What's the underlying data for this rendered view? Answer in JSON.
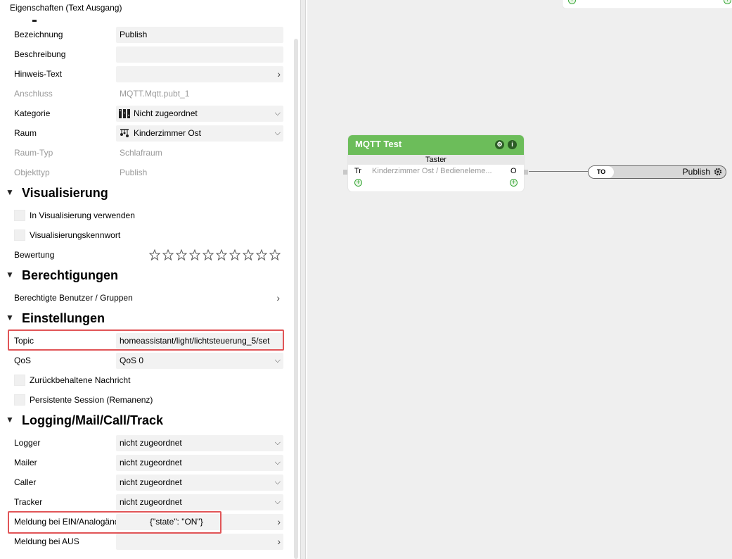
{
  "panel_title": "Eigenschaften (Text Ausgang)",
  "general": {
    "bezeichnung": {
      "label": "Bezeichnung",
      "value": "Publish"
    },
    "beschreibung": {
      "label": "Beschreibung",
      "value": ""
    },
    "hinweis": {
      "label": "Hinweis-Text",
      "value": ""
    },
    "anschluss": {
      "label": "Anschluss",
      "value": "MQTT.Mqtt.pubt_1"
    },
    "kategorie": {
      "label": "Kategorie",
      "value": "Nicht zugeordnet"
    },
    "raum": {
      "label": "Raum",
      "value": "Kinderzimmer Ost"
    },
    "raum_typ": {
      "label": "Raum-Typ",
      "value": "Schlafraum"
    },
    "objekttyp": {
      "label": "Objekttyp",
      "value": "Publish"
    }
  },
  "visualisierung": {
    "title": "Visualisierung",
    "in_vis": "In Visualisierung verwenden",
    "kennwort": "Visualisierungskennwort",
    "bewertung": "Bewertung",
    "stars_total": 10,
    "stars_filled": 0
  },
  "berechtigungen": {
    "title": "Berechtigungen",
    "benutzer": "Berechtigte Benutzer / Gruppen"
  },
  "einstellungen": {
    "title": "Einstellungen",
    "topic": {
      "label": "Topic",
      "value": "homeassistant/light/lichtsteuerung_5/set"
    },
    "qos": {
      "label": "QoS",
      "value": "QoS 0"
    },
    "retain": "Zurückbehaltene Nachricht",
    "persistent": "Persistente Session (Remanenz)"
  },
  "logging": {
    "title": "Logging/Mail/Call/Track",
    "logger": {
      "label": "Logger",
      "value": "nicht zugeordnet"
    },
    "mailer": {
      "label": "Mailer",
      "value": "nicht zugeordnet"
    },
    "caller": {
      "label": "Caller",
      "value": "nicht zugeordnet"
    },
    "tracker": {
      "label": "Tracker",
      "value": "nicht zugeordnet"
    },
    "ein": {
      "label": "Meldung bei EIN/Analogänderung",
      "value": "{\"state\": \"ON\"}"
    },
    "aus": {
      "label": "Meldung bei AUS",
      "value": ""
    }
  },
  "canvas": {
    "node": {
      "title": "MQTT Test",
      "subtitle": "Taster",
      "input": "Tr",
      "desc": "Kinderzimmer Ost / Bedieneleme...",
      "output": "O"
    },
    "output_block": {
      "tag": "TO",
      "label": "Publish"
    }
  },
  "colors": {
    "node_header": "#6cbd5a",
    "highlight": "#e15557",
    "canvas_bg": "#efefef"
  }
}
